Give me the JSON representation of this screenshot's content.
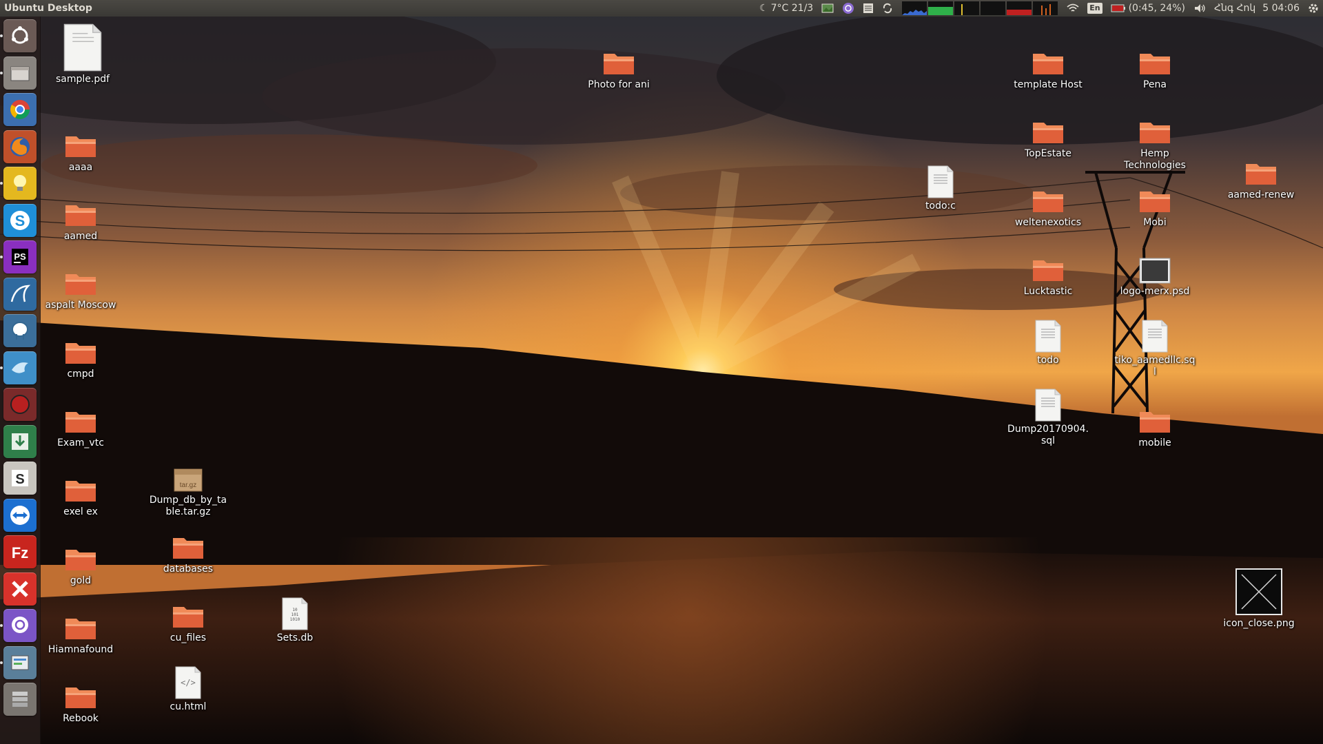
{
  "panel": {
    "title": "Ubuntu Desktop",
    "weather": "7°C 21/3",
    "battery": "(0:45, 24%)",
    "keyboard_layout": "En",
    "date": "Հնգ Հոկ",
    "time": "5 04:06"
  },
  "launcher": {
    "items": [
      {
        "name": "ubuntu-dash-icon",
        "color": "#6b5a55"
      },
      {
        "name": "files-icon",
        "color": "#8a8580"
      },
      {
        "name": "chrome-icon",
        "color": "#3c6fb0"
      },
      {
        "name": "firefox-icon",
        "color": "#c0502a"
      },
      {
        "name": "idea-bulb-icon",
        "color": "#e4b81f"
      },
      {
        "name": "skype-icon",
        "color": "#1f8fd8"
      },
      {
        "name": "phpstorm-icon",
        "color": "#8a2fc0"
      },
      {
        "name": "mysql-workbench-icon",
        "color": "#2f6aa0"
      },
      {
        "name": "pgadmin-icon",
        "color": "#3b6e9a"
      },
      {
        "name": "bird-app-icon",
        "color": "#3f8fc8"
      },
      {
        "name": "red-circle-app-icon",
        "color": "#7a2a2a"
      },
      {
        "name": "download-arrow-icon",
        "color": "#2f7f4a"
      },
      {
        "name": "slack-s-icon",
        "color": "#c9c5bf"
      },
      {
        "name": "teamviewer-icon",
        "color": "#1c6fd0"
      },
      {
        "name": "filezilla-icon",
        "color": "#c8251e"
      },
      {
        "name": "x-tool-icon",
        "color": "#d8322b"
      },
      {
        "name": "viber-icon",
        "color": "#7b55c6"
      },
      {
        "name": "software-updater-icon",
        "color": "#5a7f9a"
      },
      {
        "name": "stacked-apps-icon",
        "color": "#7a7570"
      }
    ]
  },
  "desktop": {
    "icons": [
      {
        "label": "sample.pdf",
        "type": "pdf"
      },
      {
        "label": "aaaa",
        "type": "folder"
      },
      {
        "label": "aamed",
        "type": "folder"
      },
      {
        "label": "aspalt Moscow",
        "type": "folder"
      },
      {
        "label": "cmpd",
        "type": "folder"
      },
      {
        "label": "Exam_vtc",
        "type": "folder"
      },
      {
        "label": "exel ex",
        "type": "folder"
      },
      {
        "label": "gold",
        "type": "folder"
      },
      {
        "label": "Hiamnafound",
        "type": "folder"
      },
      {
        "label": "Rebook",
        "type": "folder"
      },
      {
        "label": "Dump_db_by_table.tar.gz",
        "type": "archive"
      },
      {
        "label": "databases",
        "type": "folder"
      },
      {
        "label": "cu_files",
        "type": "folder"
      },
      {
        "label": "cu.html",
        "type": "html"
      },
      {
        "label": "Sets.db",
        "type": "binary"
      },
      {
        "label": "Photo for ani",
        "type": "folder"
      },
      {
        "label": "todo:c",
        "type": "text"
      },
      {
        "label": "template Host",
        "type": "folder"
      },
      {
        "label": "TopEstate",
        "type": "folder"
      },
      {
        "label": "weltenexotics",
        "type": "folder"
      },
      {
        "label": "Lucktastic",
        "type": "folder"
      },
      {
        "label": "todo",
        "type": "text"
      },
      {
        "label": "Dump20170904.sql",
        "type": "text"
      },
      {
        "label": "Pena",
        "type": "folder"
      },
      {
        "label": "Hemp Technologies",
        "type": "folder"
      },
      {
        "label": "Mobi",
        "type": "folder"
      },
      {
        "label": "logo-merx.psd",
        "type": "psd"
      },
      {
        "label": "tiko_aamedllc.sql",
        "type": "text"
      },
      {
        "label": "mobile",
        "type": "folder"
      },
      {
        "label": "aamed-renew",
        "type": "folder"
      },
      {
        "label": "icon_close.png",
        "type": "image"
      }
    ]
  },
  "colors": {
    "folder_top": "#f08a58",
    "folder_body": "#e0603a",
    "panel_bg": "#3a3935",
    "panel_text": "#dfdbd2"
  }
}
